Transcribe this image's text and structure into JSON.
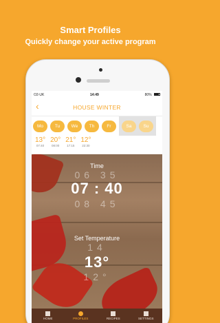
{
  "promo": {
    "title": "Smart Profiles",
    "subtitle": "Quickly change your active program"
  },
  "status": {
    "carrier": "O2-UK",
    "time": "14:49",
    "battery": "80%"
  },
  "nav": {
    "back_icon": "chevron-left-icon",
    "title": "HOUSE WINTER"
  },
  "days": [
    "Mo",
    "Tu",
    "We",
    "Th",
    "Fr",
    "Sa",
    "Su"
  ],
  "slots": [
    {
      "temp": "13°",
      "time": "07:40"
    },
    {
      "temp": "20°",
      "time": "08:00"
    },
    {
      "temp": "21°",
      "time": "17:15"
    },
    {
      "temp": "12°",
      "time": "22:30"
    }
  ],
  "time_panel": {
    "label": "Time",
    "value": "07 : 40",
    "above": "06 35",
    "below": "08 45"
  },
  "temp_panel": {
    "label": "Set Temperature",
    "value": "13°",
    "above": "14",
    "below": "12°"
  },
  "tabs": [
    {
      "label": "HOME",
      "icon": "home-icon"
    },
    {
      "label": "PROFILES",
      "icon": "clock-icon"
    },
    {
      "label": "RECIPES",
      "icon": "list-icon"
    },
    {
      "label": "SETTINGS",
      "icon": "gear-icon"
    }
  ],
  "colors": {
    "accent": "#f6a72d",
    "tabbar": "#5a3320"
  }
}
